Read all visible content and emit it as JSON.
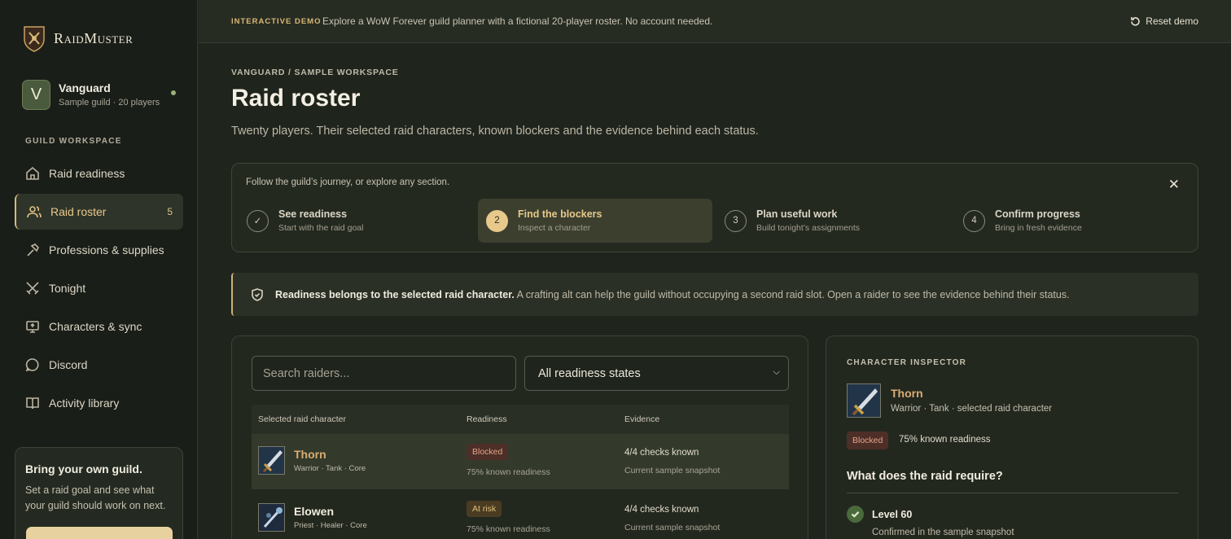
{
  "brand": {
    "name": "RaidMuster"
  },
  "guild": {
    "initial": "V",
    "name": "Vanguard",
    "subtitle": "Sample guild · 20 players"
  },
  "sidebar": {
    "section_label": "GUILD WORKSPACE",
    "items": [
      {
        "label": "Raid readiness",
        "icon": "home-icon"
      },
      {
        "label": "Raid roster",
        "icon": "users-icon",
        "count": "5"
      },
      {
        "label": "Professions & supplies",
        "icon": "hammer-icon"
      },
      {
        "label": "Tonight",
        "icon": "crossed-swords-icon"
      },
      {
        "label": "Characters & sync",
        "icon": "monitor-icon"
      },
      {
        "label": "Discord",
        "icon": "chat-icon"
      },
      {
        "label": "Activity library",
        "icon": "book-icon"
      }
    ],
    "promo": {
      "title": "Bring your own guild.",
      "text": "Set a raid goal and see what your guild should work on next."
    }
  },
  "topbar": {
    "tag": "INTERACTIVE DEMO",
    "text": "Explore a WoW Forever guild planner with a fictional 20-player roster. No account needed.",
    "reset_label": "Reset demo"
  },
  "page": {
    "breadcrumb": "VANGUARD / SAMPLE WORKSPACE",
    "title": "Raid roster",
    "subtitle": "Twenty players. Their selected raid characters, known blockers and the evidence behind each status."
  },
  "journey": {
    "intro": "Follow the guild’s journey, or explore any section.",
    "close": "✕",
    "steps": [
      {
        "num": "✓",
        "title": "See readiness",
        "sub": "Start with the raid goal"
      },
      {
        "num": "2",
        "title": "Find the blockers",
        "sub": "Inspect a character"
      },
      {
        "num": "3",
        "title": "Plan useful work",
        "sub": "Build tonight’s assignments"
      },
      {
        "num": "4",
        "title": "Confirm progress",
        "sub": "Bring in fresh evidence"
      }
    ]
  },
  "notice": {
    "bold": "Readiness belongs to the selected raid character.",
    "text": " A crafting alt can help the guild without occupying a second raid slot. Open a raider to see the evidence behind their status."
  },
  "roster": {
    "search_placeholder": "Search raiders...",
    "filter_value": "All readiness states",
    "columns": [
      "Selected raid character",
      "Readiness",
      "Evidence"
    ],
    "rows": [
      {
        "name": "Thorn",
        "meta": "Warrior · Tank · Core",
        "badge": "Blocked",
        "pct": "75% known readiness",
        "ev1": "4/4 checks known",
        "ev2": "Current sample snapshot"
      },
      {
        "name": "Elowen",
        "meta": "Priest · Healer · Core",
        "badge": "At risk",
        "pct": "75% known readiness",
        "ev1": "4/4 checks known",
        "ev2": "Current sample snapshot"
      }
    ]
  },
  "inspector": {
    "label": "CHARACTER INSPECTOR",
    "name": "Thorn",
    "meta": "Warrior · Tank · selected raid character",
    "badge": "Blocked",
    "pct": "75% known readiness",
    "question": "What does the raid require?",
    "req_title": "Level 60",
    "req_sub": "Confirmed in the sample snapshot"
  },
  "colors": {
    "accent": "#e7c98b",
    "background": "#1f241d",
    "blocked": "#e3a48a",
    "at_risk": "#e1be7e"
  }
}
